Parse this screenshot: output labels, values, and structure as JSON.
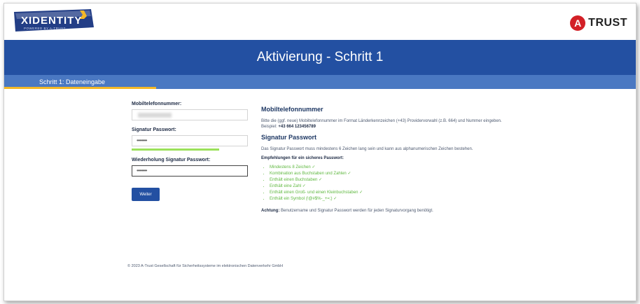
{
  "header": {
    "logo_left_text": "XIDENTITY",
    "logo_left_sub": "POWERED BY A-TRUST",
    "logo_right_badge": "A",
    "logo_right_text": "TRUST"
  },
  "banner": {
    "title": "Aktivierung - Schritt 1"
  },
  "steps": {
    "current": "Schritt 1: Dateneingabe"
  },
  "form": {
    "phone_label": "Mobiltelefonnummer:",
    "password_label": "Signatur Passwort:",
    "password_value": "••••••••",
    "password_repeat_label": "Wiederholung Signatur Passwort:",
    "password_repeat_value": "••••••••",
    "submit_label": "Weiter",
    "strength": 0.75
  },
  "info": {
    "phone_heading": "Mobiltelefonnummer",
    "phone_text": "Bitte die (ggf. neue) Mobiltelefonnummer im Format Länderkennzeichen (+43) Providervorwahl (z.B. 664) und Nummer eingeben.",
    "phone_example_label": "Beispiel:",
    "phone_example": "+43 664 123456789",
    "password_heading": "Signatur Passwort",
    "password_text": "Das Signatur Passwort muss mindestens 6 Zeichen lang sein und kann aus alphanumerischen Zeichen bestehen.",
    "recommend_heading": "Empfehlungen für ein sicheres Passwort:",
    "recommendations": [
      "Mindestens 8 Zeichen ✓",
      "Kombination aus Buchstaben und Zahlen ✓",
      "Enthält einen Buchstaben ✓",
      "Enthält eine Zahl ✓",
      "Enthält einen Groß- und einen Kleinbuchstaben ✓",
      "Enthält ein Symbol (!@#$%-_+=;) ✓"
    ],
    "note_label": "Achtung:",
    "note_text": "Benutzername und Signatur Passwort werden für jeden Signaturvorgang benötigt."
  },
  "footer": {
    "text": "© 2023 A-Trust Gesellschaft für Sicherheitssysteme im elektronischen Datenverkehr GmbH"
  },
  "colors": {
    "primary": "#2350a2",
    "step_bar": "#4a78c2",
    "accent": "#f4b826",
    "success": "#5fb840"
  }
}
